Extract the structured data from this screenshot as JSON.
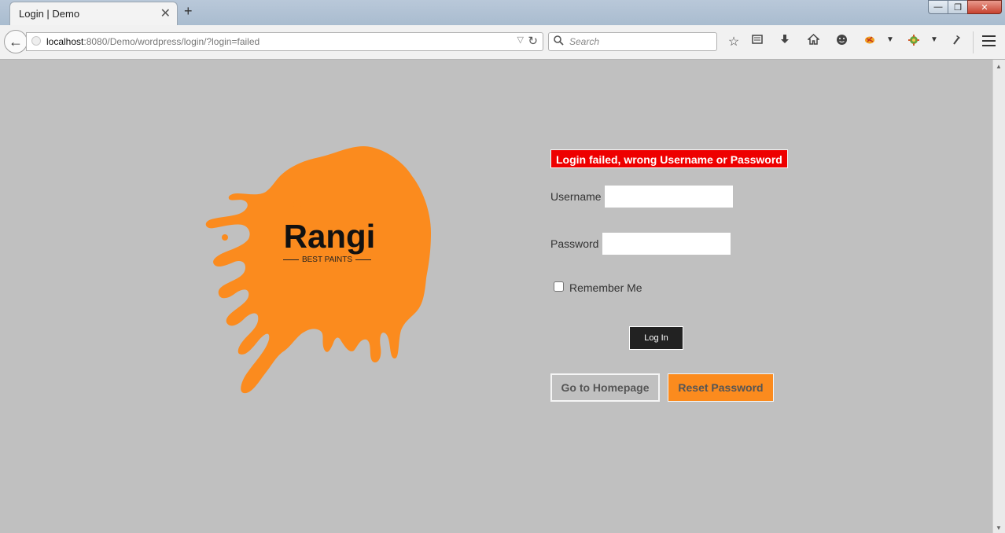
{
  "browser": {
    "tab_title": "Login | Demo",
    "tab_close": "✕",
    "new_tab": "+",
    "url_host": "localhost",
    "url_rest": ":8080/Demo/wordpress/login/?login=failed",
    "search_placeholder": "Search",
    "window_controls": {
      "minimize": "—",
      "restore": "❐",
      "close": "✕"
    }
  },
  "brand": {
    "name": "Rangi",
    "tagline": "BEST PAINTS",
    "splash_color": "#fb8b1e"
  },
  "login": {
    "error_message": "Login failed, wrong Username or Password",
    "username_label": "Username",
    "username_value": "",
    "password_label": "Password",
    "password_value": "",
    "remember_label": "Remember Me",
    "remember_checked": false,
    "submit_label": "Log In",
    "homepage_label": "Go to Homepage",
    "reset_label": "Reset Password"
  },
  "colors": {
    "page_bg": "#c0c0c0",
    "error_bg": "#ee0000",
    "accent": "#fb8b1e",
    "button_dark": "#222222"
  }
}
